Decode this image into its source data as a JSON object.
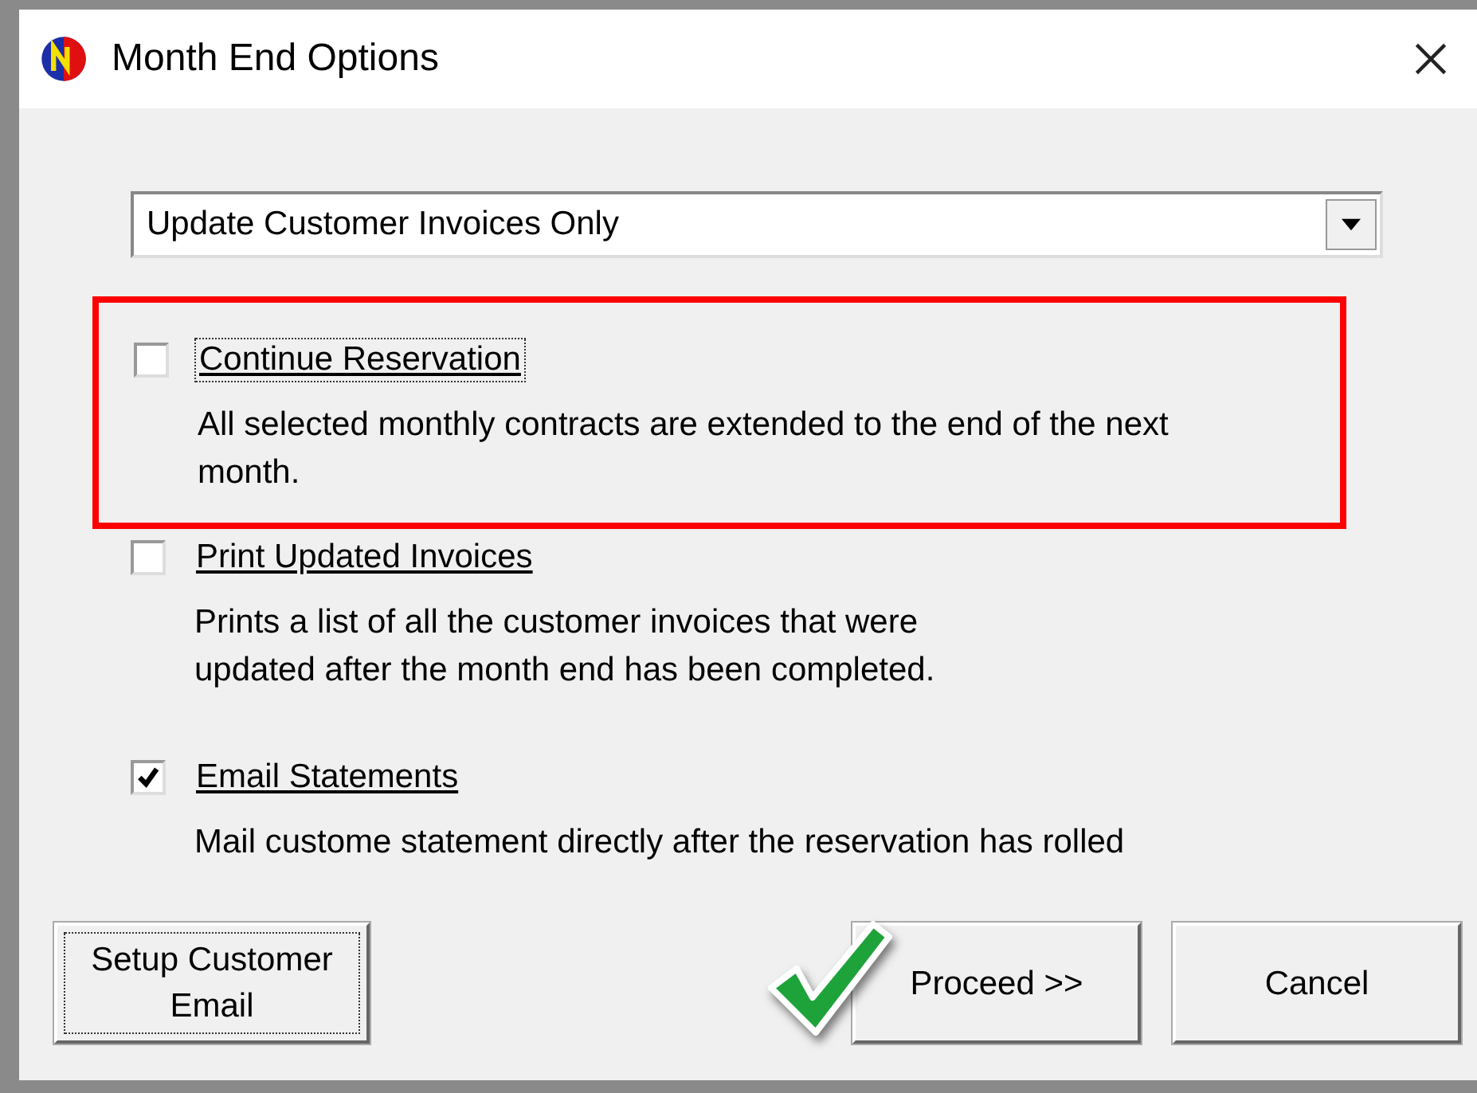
{
  "window": {
    "title": "Month End Options"
  },
  "dropdown": {
    "value": "Update Customer Invoices Only"
  },
  "options": [
    {
      "label": "Continue Reservation",
      "checked": false,
      "focused": true,
      "highlighted": true,
      "description": "All selected monthly contracts are extended to the end of the next\nmonth."
    },
    {
      "label": "Print Updated Invoices",
      "checked": false,
      "focused": false,
      "highlighted": false,
      "description": "Prints a list of all the customer invoices that were\nupdated after the month end has been completed."
    },
    {
      "label": "Email Statements",
      "checked": true,
      "focused": false,
      "highlighted": false,
      "description": "Mail custome statement directly after the reservation has rolled"
    }
  ],
  "buttons": [
    {
      "label": "Setup Customer\nEmail",
      "focused": true
    },
    {
      "label": "Proceed >>",
      "focused": false
    },
    {
      "label": "Cancel",
      "focused": false
    }
  ]
}
